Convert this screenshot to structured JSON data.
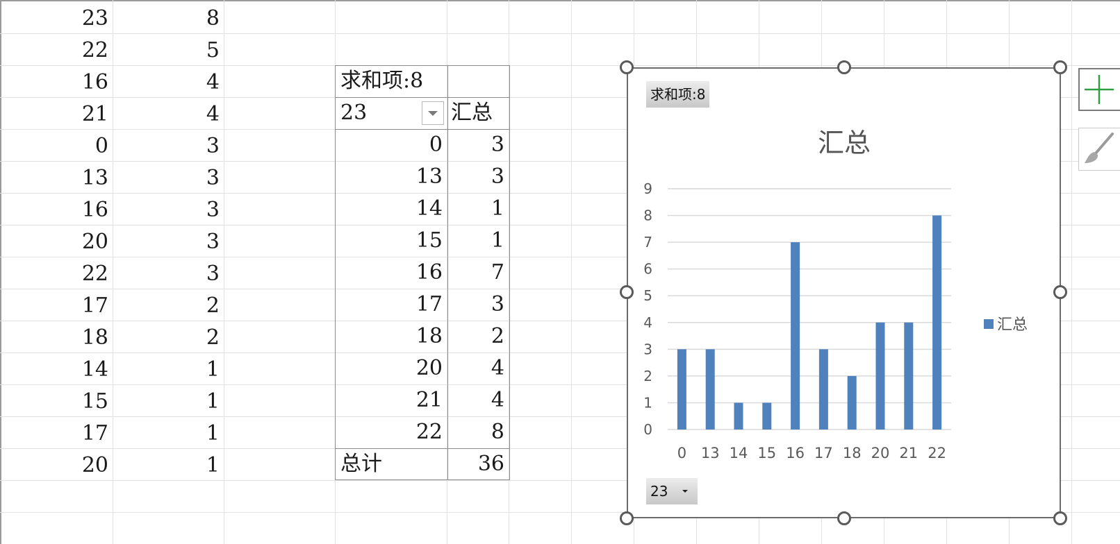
{
  "columns_left": {
    "col_a": [
      "23",
      "22",
      "16",
      "21",
      "0",
      "13",
      "16",
      "20",
      "22",
      "17",
      "18",
      "14",
      "15",
      "17",
      "20"
    ],
    "col_b": [
      "8",
      "5",
      "4",
      "4",
      "3",
      "3",
      "3",
      "3",
      "3",
      "2",
      "2",
      "1",
      "1",
      "1",
      "1"
    ]
  },
  "pivot": {
    "header": "求和项:8",
    "row_field": "23",
    "value_col": "汇总",
    "rows": [
      {
        "label": "0",
        "value": "3"
      },
      {
        "label": "13",
        "value": "3"
      },
      {
        "label": "14",
        "value": "1"
      },
      {
        "label": "15",
        "value": "1"
      },
      {
        "label": "16",
        "value": "7"
      },
      {
        "label": "17",
        "value": "3"
      },
      {
        "label": "18",
        "value": "2"
      },
      {
        "label": "20",
        "value": "4"
      },
      {
        "label": "21",
        "value": "4"
      },
      {
        "label": "22",
        "value": "8"
      }
    ],
    "total_label": "总计",
    "total_value": "36"
  },
  "chart_buttons": {
    "value_field": "求和项:8",
    "axis_field": "23"
  },
  "chart_data": {
    "type": "bar",
    "title": "汇总",
    "categories": [
      "0",
      "13",
      "14",
      "15",
      "16",
      "17",
      "18",
      "20",
      "21",
      "22"
    ],
    "series": [
      {
        "name": "汇总",
        "values": [
          3,
          3,
          1,
          1,
          7,
          3,
          2,
          4,
          4,
          8
        ],
        "color": "#4f81bd"
      }
    ],
    "ylim": [
      0,
      9
    ],
    "yticks": [
      0,
      1,
      2,
      3,
      4,
      5,
      6,
      7,
      8,
      9
    ],
    "grid": true,
    "legend": "right"
  },
  "side_buttons": {
    "add_icon": "plus-icon",
    "style_icon": "paintbrush-icon",
    "add_color": "#2e9e3e"
  }
}
